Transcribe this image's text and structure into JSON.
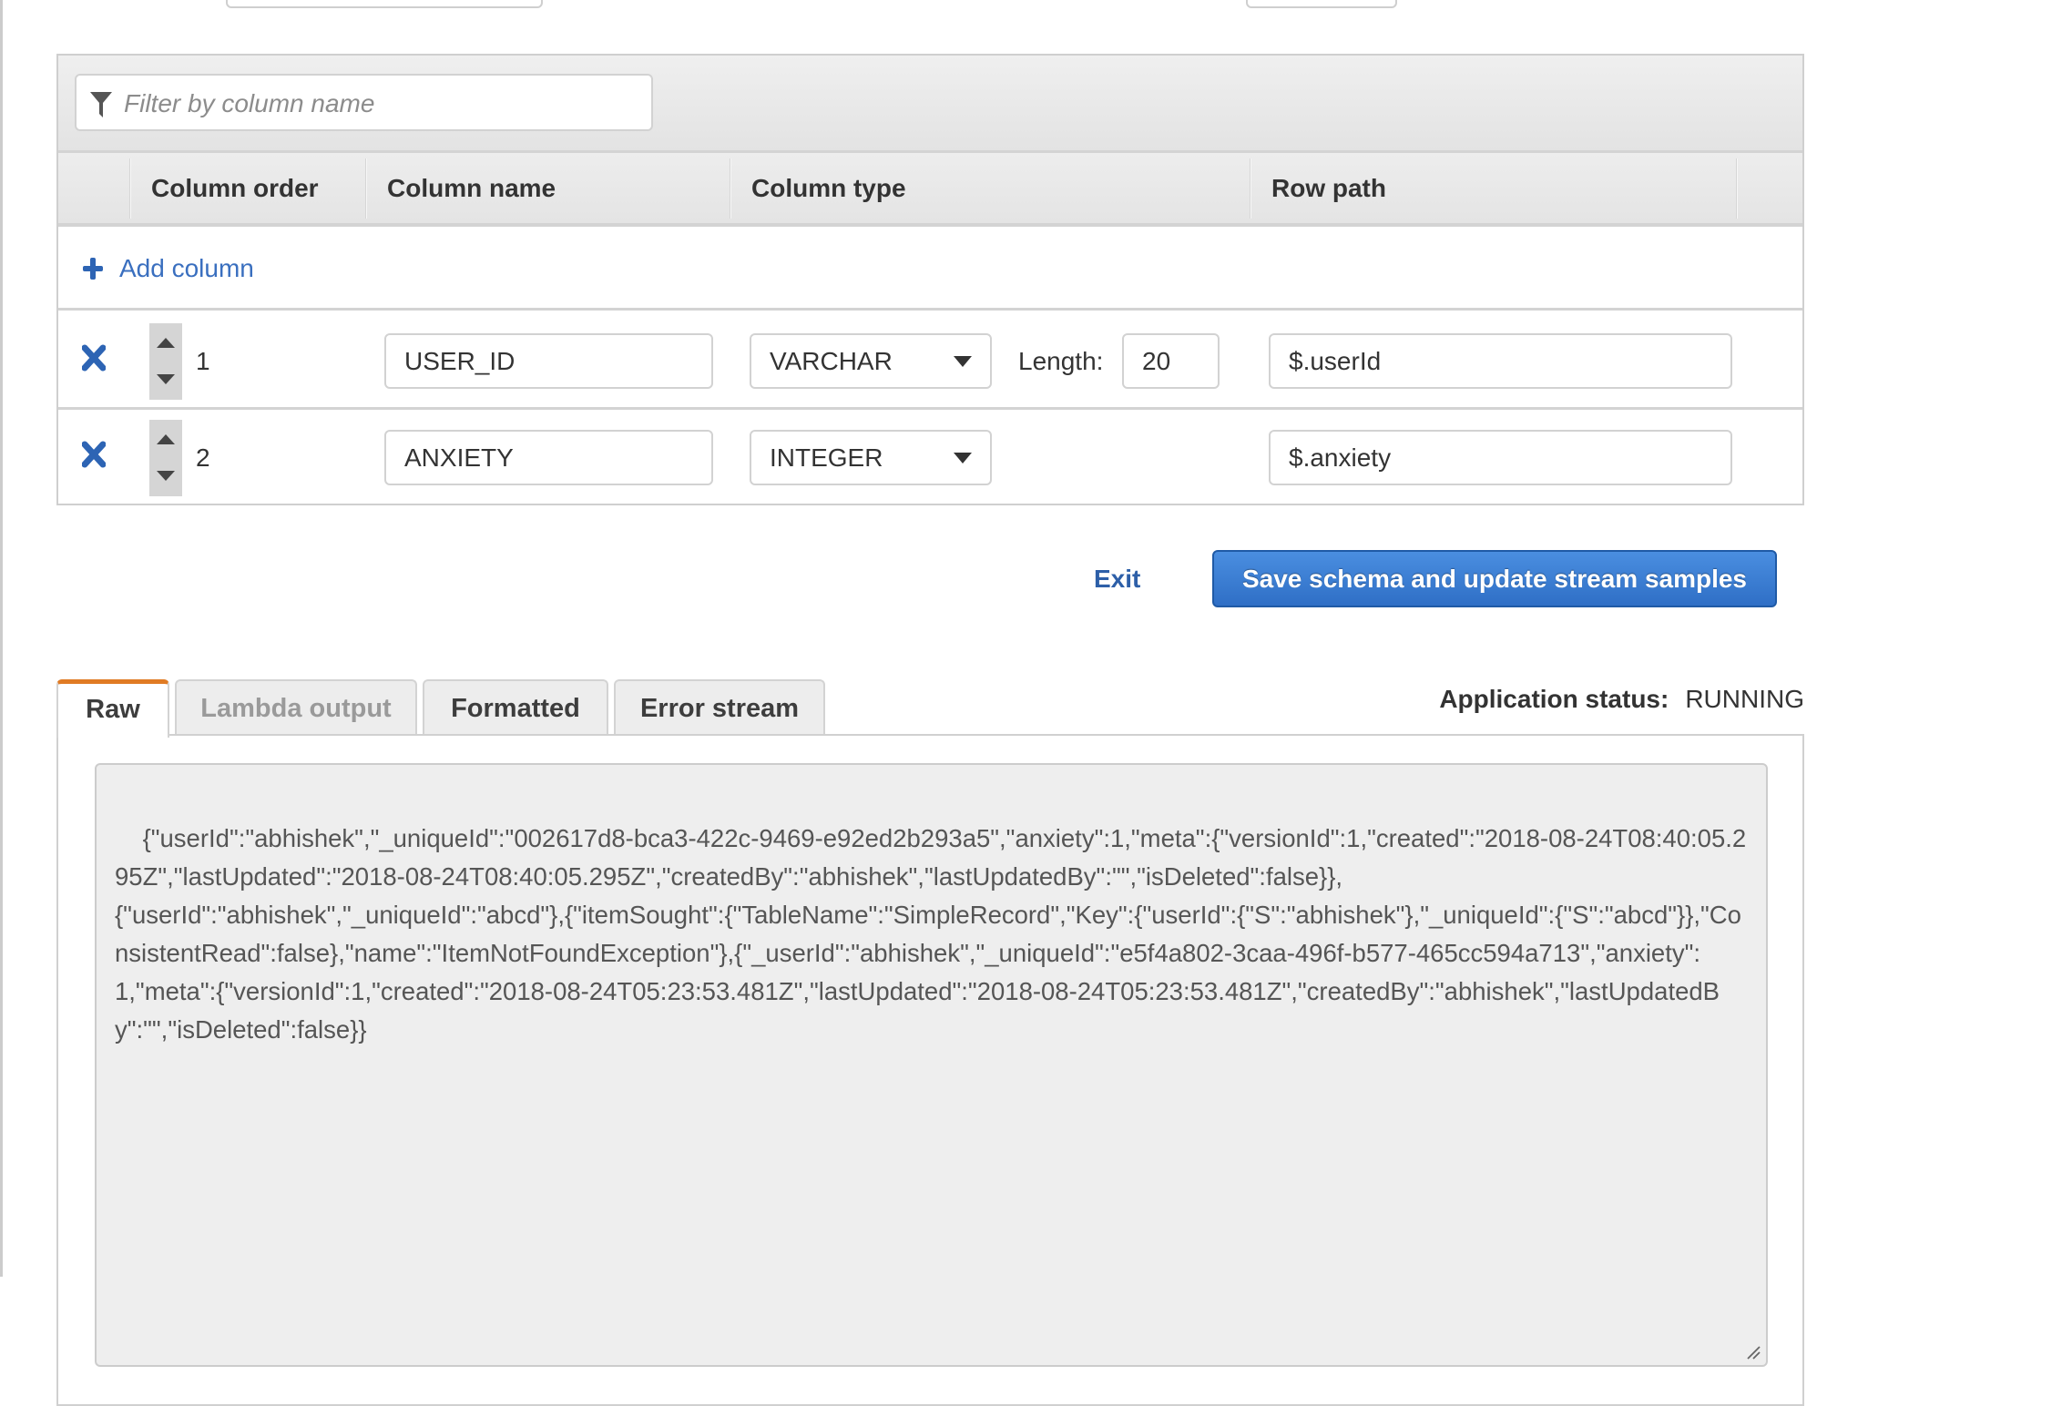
{
  "schema_editor": {
    "filter": {
      "placeholder": "Filter by column name",
      "value": ""
    },
    "columns_header": {
      "order": "Column order",
      "name": "Column name",
      "type": "Column type",
      "row_path": "Row path"
    },
    "add_column_label": "Add column",
    "length_label": "Length:",
    "rows": [
      {
        "order": "1",
        "name": "USER_ID",
        "type": "VARCHAR",
        "length": "20",
        "row_path": "$.userId"
      },
      {
        "order": "2",
        "name": "ANXIETY",
        "type": "INTEGER",
        "row_path": "$.anxiety"
      }
    ],
    "exit_label": "Exit",
    "save_label": "Save schema and update stream samples"
  },
  "samples": {
    "tabs": [
      {
        "label": "Raw",
        "state": "active"
      },
      {
        "label": "Lambda output",
        "state": "disabled"
      },
      {
        "label": "Formatted",
        "state": "normal"
      },
      {
        "label": "Error stream",
        "state": "normal"
      }
    ],
    "status_label": "Application status:",
    "status_value": "RUNNING",
    "raw_text": "{\"userId\":\"abhishek\",\"_uniqueId\":\"002617d8-bca3-422c-9469-e92ed2b293a5\",\"anxiety\":1,\"meta\":{\"versionId\":1,\"created\":\"2018-08-24T08:40:05.295Z\",\"lastUpdated\":\"2018-08-24T08:40:05.295Z\",\"createdBy\":\"abhishek\",\"lastUpdatedBy\":\"\",\"isDeleted\":false}},\n{\"userId\":\"abhishek\",\"_uniqueId\":\"abcd\"},{\"itemSought\":{\"TableName\":\"SimpleRecord\",\"Key\":{\"userId\":{\"S\":\"abhishek\"},\"_uniqueId\":{\"S\":\"abcd\"}},\"ConsistentRead\":false},\"name\":\"ItemNotFoundException\"},{\"_userId\":\"abhishek\",\"_uniqueId\":\"e5f4a802-3caa-496f-b577-465cc594a713\",\"anxiety\":1,\"meta\":{\"versionId\":1,\"created\":\"2018-08-24T05:23:53.481Z\",\"lastUpdated\":\"2018-08-24T05:23:53.481Z\",\"createdBy\":\"abhishek\",\"lastUpdatedBy\":\"\",\"isDeleted\":false}}"
  },
  "icons": {
    "filter": "filter-icon",
    "add": "plus-icon",
    "delete": "close-x-icon",
    "move_up": "caret-up-icon",
    "move_down": "caret-down-icon",
    "dropdown": "caret-down-icon",
    "resize": "resize-grip-icon"
  },
  "colors": {
    "accent_tab": "#e07b24",
    "link": "#2d64b4",
    "primary_button": "#3a7bd5"
  }
}
